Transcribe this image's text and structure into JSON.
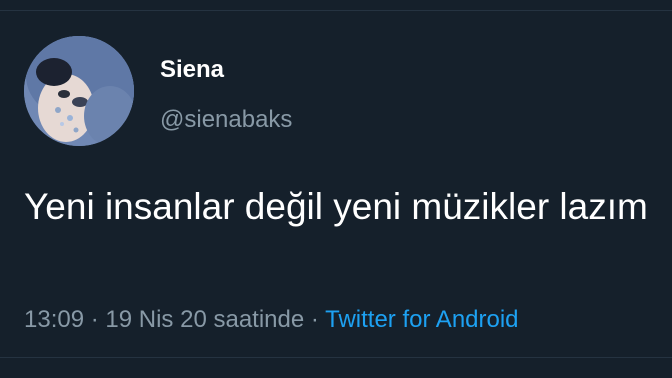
{
  "user": {
    "display_name": "Siena",
    "handle": "@sienabaks",
    "avatar_icon": "profile-photo"
  },
  "tweet": {
    "text": "Yeni insanlar değil yeni müzikler lazım",
    "time": "13:09",
    "separator": "·",
    "date_suffix": "19 Nis 20 saatinde",
    "source": "Twitter for Android"
  },
  "colors": {
    "background": "#15202b",
    "primary_text": "#ffffff",
    "secondary_text": "#8899a6",
    "link": "#1da1f2",
    "divider": "#253341"
  }
}
